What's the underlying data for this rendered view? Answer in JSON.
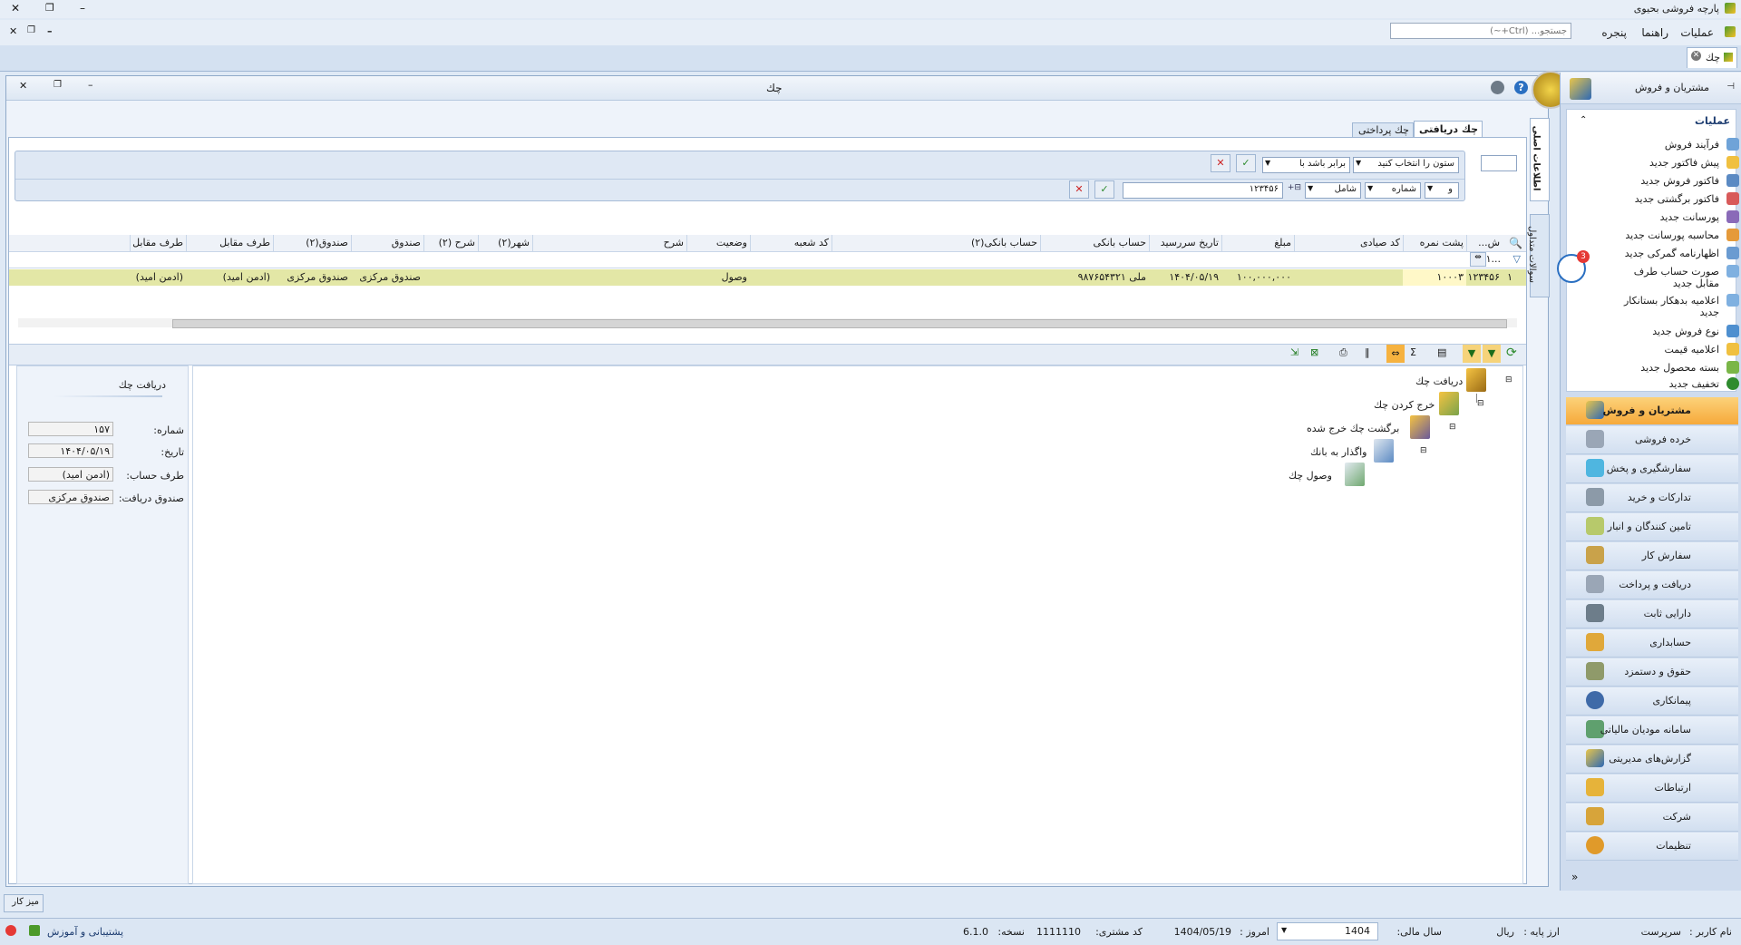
{
  "window": {
    "title": "پارچه فروشی بحیوی",
    "btn_min": "–",
    "btn_restore": "❐",
    "btn_close": "✕"
  },
  "menu": {
    "items": [
      "عملیات",
      "راهنما",
      "پنجره"
    ],
    "search_placeholder": "جستجو... (Ctrl+~)",
    "mdi_close": "✕",
    "mdi_restore": "❐",
    "mdi_min": "–"
  },
  "doc_tab": {
    "label": "چك",
    "close": "✕"
  },
  "inner_window": {
    "title": "چك",
    "btn_close": "✕",
    "btn_restore": "❐",
    "btn_min": "–",
    "help": "?"
  },
  "tabs": {
    "received": "چك دریافتی",
    "paid": "چك پرداختی"
  },
  "side_tabs": {
    "main_info": "اطلاعات اصلی",
    "frequent_questions": "سوالات متداول"
  },
  "filter": {
    "row1": {
      "column_select": "ستون را انتخاب كنید",
      "operator": "برابر باشد با"
    },
    "row2": {
      "logic": "و",
      "column": "شماره",
      "operator": "شامل",
      "value": "۱۲۳۴۵۶"
    }
  },
  "grid": {
    "columns": [
      "ش...",
      "پشت نمره",
      "كد صیادی",
      "مبلغ",
      "تاریخ سررسید",
      "حساب بانكی",
      "حساب بانكی(۲)",
      "كد شعبه",
      "وضعیت",
      "شرح",
      "شهر(۲)",
      "شرح (۲)",
      "صندوق",
      "صندوق(۲)",
      "طرف مقابل",
      "طرف مقابل"
    ],
    "filter_row_hint": "۱...",
    "rows": [
      {
        "idx": "۱",
        "number": "۱۲۳۴۵۶",
        "back_number": "۱۰۰۰۳",
        "sayadi": "",
        "amount": "۱۰۰,۰۰۰,۰۰۰",
        "due_date": "۱۴۰۴/۰۵/۱۹",
        "bank_account": "ملی  ۹۸۷۶۵۴۳۲۱",
        "bank_account2": "",
        "branch_code": "",
        "status": "وصول",
        "desc": "",
        "city2": "",
        "desc2": "",
        "fund": "صندوق مركزی",
        "fund2": "صندوق مركزی",
        "party": "(ادمن امید)",
        "party2": "(ادمن امید)"
      }
    ]
  },
  "details": {
    "title": "دریافت چك",
    "fields": [
      {
        "label": "شماره:",
        "value": "۱۵۷"
      },
      {
        "label": "تاریخ:",
        "value": "۱۴۰۴/۰۵/۱۹"
      },
      {
        "label": "طرف حساب:",
        "value": "(ادمن امید)"
      },
      {
        "label": "صندوق دریافت:",
        "value": "صندوق مركزی"
      }
    ]
  },
  "flow": {
    "nodes": [
      "دریافت چك",
      "خرج كردن چك",
      "برگشت چك خرج شده",
      "واگذار به بانك",
      "وصول چك"
    ]
  },
  "nav": {
    "header": "مشتریان و فروش",
    "pin": "📌",
    "ops_title": "عملیات",
    "ops": [
      "فرآیند فروش",
      "پیش فاكتور جدید",
      "فاكتور فروش جدید",
      "فاكتور برگشتی جدید",
      "پورسانت جدید",
      "محاسبه پورسانت جدید",
      "اظهارنامه گمركی جدید",
      "صورت حساب طرف مقابل جدید",
      "اعلامیه بدهكار بستانكار جدید",
      "نوع فروش جدید",
      "اعلامیه قیمت",
      "بسته محصول جدید",
      "تخفیف جدید"
    ],
    "modules": [
      "مشتریان و فروش",
      "خرده فروشی",
      "سفارشگیری و پخش",
      "تداركات و خرید",
      "تامین كنندگان و انبار",
      "سفارش كار",
      "دریافت و پرداخت",
      "دارایی ثابت",
      "حسابداری",
      "حقوق و دستمزد",
      "پیمانكاری",
      "سامانه مودیان مالیاتی",
      "گزارش‌های مدیریتی",
      "ارتباطات",
      "شركت",
      "تنظیمات"
    ],
    "badge": "3"
  },
  "desktop_btn": "میز كار",
  "status": {
    "user_label": "نام كاربر :",
    "user": "سرپرست",
    "currency_label": "ارز پایه :",
    "currency": "ریال",
    "fiscal_label": "سال مالی:",
    "fiscal": "1404",
    "today_label": "امروز :",
    "today": "1404/05/19",
    "customer_label": "كد مشتری:",
    "customer": "1111110",
    "version_label": "نسخه:",
    "version": "6.1.0",
    "support": "پشتیبانی و آموزش"
  },
  "colors": {
    "accent": "#f7a32a",
    "selected_row": "#e3e7a6",
    "nav_active": "#f6b23f"
  }
}
